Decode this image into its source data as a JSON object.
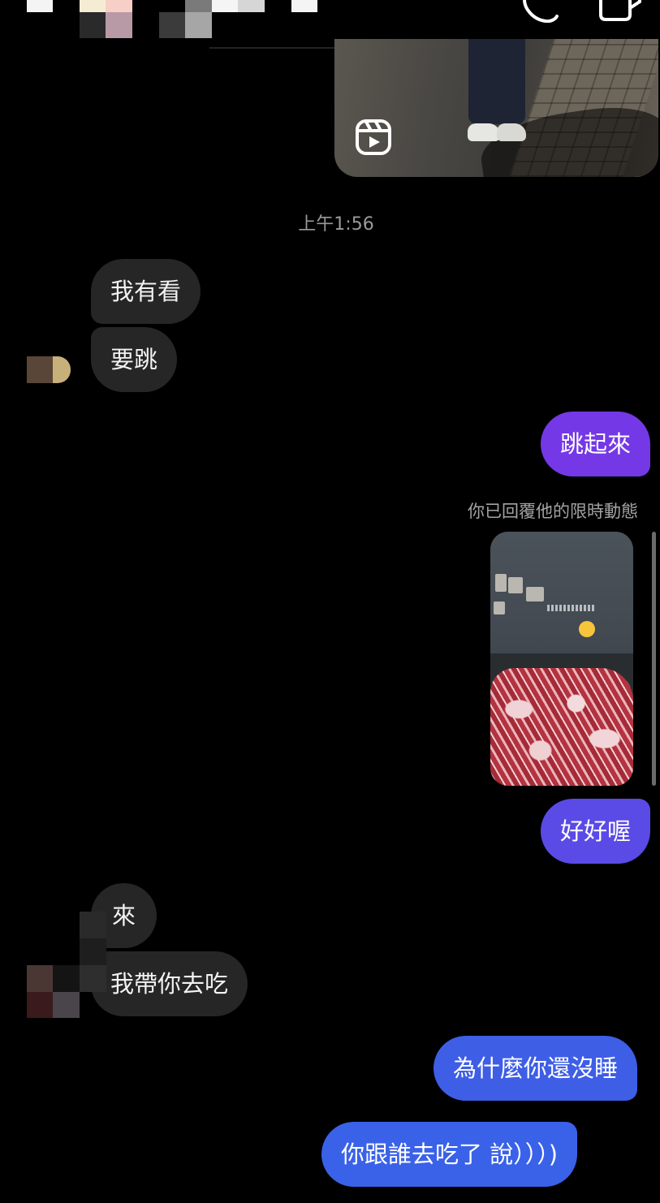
{
  "header": {
    "icons": [
      "phone-icon",
      "video-icon"
    ]
  },
  "reel": {
    "icon": "reels-play-icon"
  },
  "chat": {
    "timestamp": "上午1:56",
    "messages": [
      {
        "from": "them",
        "text": "我有看"
      },
      {
        "from": "them",
        "text": "要跳"
      },
      {
        "from": "me",
        "text": "跳起來"
      },
      {
        "from": "me",
        "text": "好好喔"
      },
      {
        "from": "them",
        "text": "來"
      },
      {
        "from": "them",
        "text": "我帶你去吃"
      },
      {
        "from": "me",
        "text": "為什麼你還沒睡"
      },
      {
        "from": "me",
        "text": "你跟誰去吃了 說）））)"
      }
    ],
    "story_reply_caption": "你已回覆他的限時動態"
  },
  "colors": {
    "background": "#000000",
    "incoming_bubble": "#262626",
    "outgoing_gradient_top": "#7a3ee6",
    "outgoing_gradient_bottom": "#3d63e6",
    "secondary_text": "#9a9a9a"
  }
}
